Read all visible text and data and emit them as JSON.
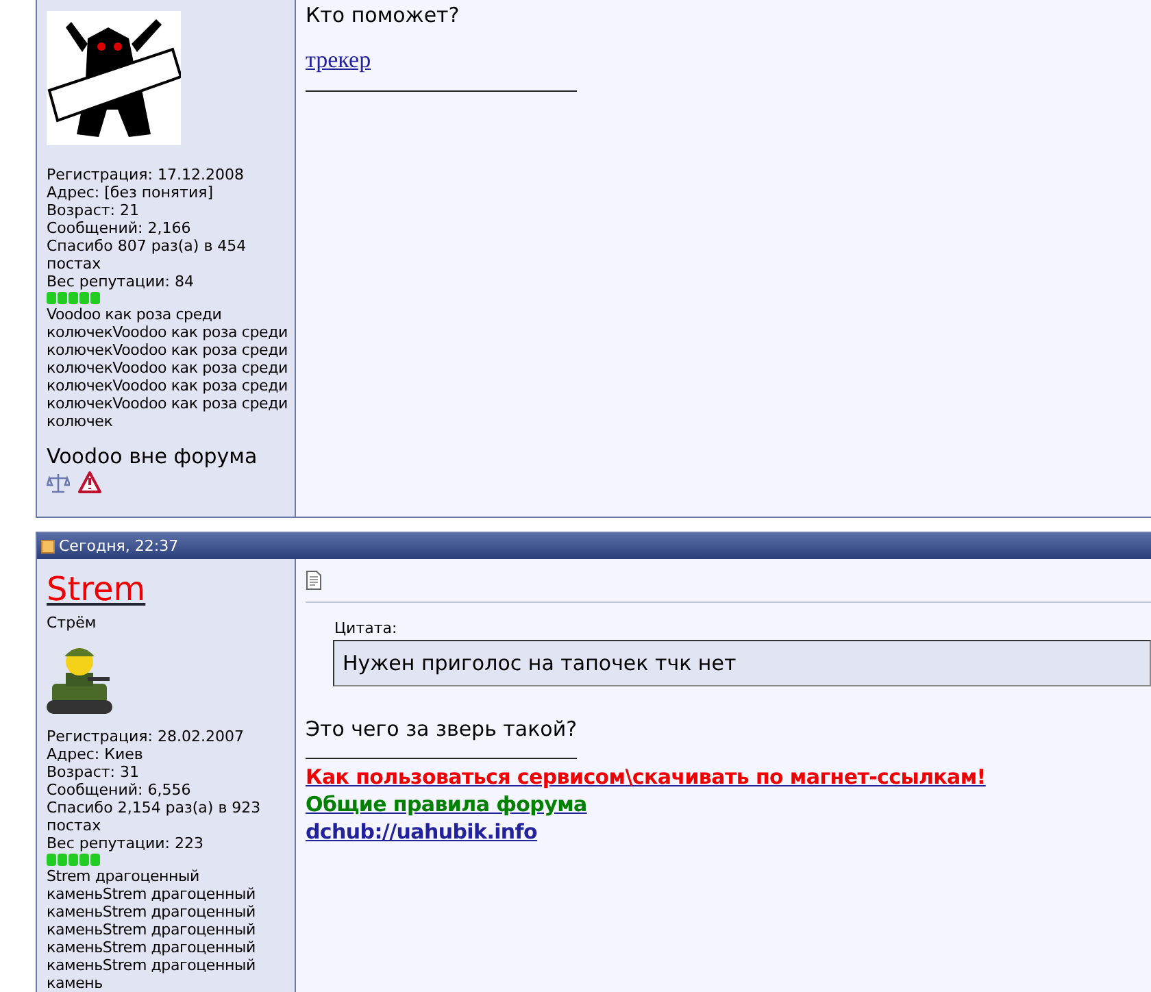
{
  "posts": [
    {
      "user": {
        "stats": [
          "Регистрация: 17.12.2008",
          "Адрес: [без понятия]",
          "Возраст: 21",
          "Сообщений: 2,166",
          "Спасибо 807 раз(а) в 454 постах",
          "Вес репутации: 84"
        ],
        "reputation": {
          "stars": 5,
          "text": "Voodoo как роза среди колючекVoodoo как роза среди колючекVoodoo как роза среди колючекVoodoo как роза среди колючекVoodoo как роза среди колючекVoodoo как роза среди колючек"
        },
        "status": "Voodoo вне форума"
      },
      "message": {
        "body": [
          {
            "kind": "text",
            "text": "Кто поможет?"
          },
          {
            "kind": "link",
            "text": "трекер"
          }
        ]
      }
    },
    {
      "date": "Сегодня, 22:37",
      "user": {
        "name": "Strem",
        "title": "Стрём",
        "stats": [
          "Регистрация: 28.02.2007",
          "Адрес: Киев",
          "Возраст: 31",
          "Сообщений: 6,556",
          "Спасибо 2,154 раз(а) в 923 постах",
          "Вес репутации: 223"
        ],
        "reputation": {
          "stars": 5,
          "text": "Strem драгоценный каменьStrem драгоценный каменьStrem драгоценный каменьStrem драгоценный каменьStrem драгоценный каменьStrem драгоценный камень"
        }
      },
      "message": {
        "quote": {
          "label": "Цитата:",
          "text": "Нужен приголос на тапочек тчк нет"
        },
        "body": [
          {
            "kind": "text",
            "text": "Это чего за зверь такой?"
          }
        ],
        "signature": [
          {
            "text": "Как пользоваться сервисом\\скачивать по магнет-ссылкам!",
            "color": "#ee0000"
          },
          {
            "text": "Общие правила форума",
            "color": "#008000"
          },
          {
            "text": "dchub://uahubik.info",
            "color": "#22229c"
          }
        ]
      }
    }
  ]
}
